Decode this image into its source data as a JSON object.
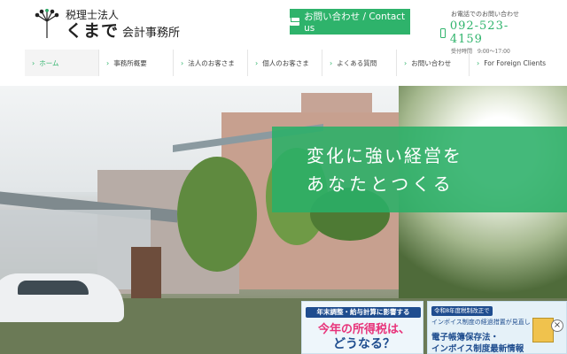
{
  "logo": {
    "subtitle": "税理士法人",
    "name": "くまで",
    "office": "会計事務所",
    "icon": "kumade-rake-icon"
  },
  "header": {
    "contact_button": "お問い合わせ / Contact us",
    "phone_caption": "お電話でのお問い合わせ",
    "phone_number": "092-523-4159",
    "phone_hours": "受付時間　9:00～17:00"
  },
  "nav": {
    "items": [
      {
        "label": "ホーム",
        "active": true
      },
      {
        "label": "事務所概要",
        "active": false
      },
      {
        "label": "法人のお客さま",
        "active": false
      },
      {
        "label": "個人のお客さま",
        "active": false
      },
      {
        "label": "よくある質問",
        "active": false
      },
      {
        "label": "お問い合わせ",
        "active": false
      },
      {
        "label": "For Foreign Clients",
        "active": false
      }
    ]
  },
  "hero": {
    "line1": "変化に強い経営を",
    "line2": "あなたとつくる"
  },
  "banners": {
    "b1_top": "年末調整・給与計算に影響する",
    "b1_mid": "今年の所得税は、",
    "b1_bot": "どうなる？",
    "b2_tag": "令和8年度税制改正で",
    "b2_line": "インボイス制度の経過措置が見直し",
    "b2_main1": "電子帳簿保存法・",
    "b2_main2": "インボイス制度最新情報"
  },
  "colors": {
    "accent": "#2eb36b",
    "banner_navy": "#1f4d8f",
    "banner_pink": "#e8337a"
  }
}
